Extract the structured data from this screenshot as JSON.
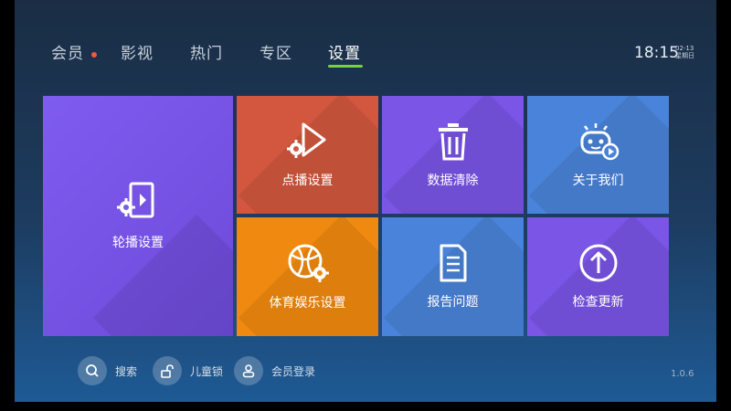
{
  "nav": {
    "items": [
      "会员",
      "影视",
      "热门",
      "专区",
      "设置"
    ],
    "active_index": 4
  },
  "status": {
    "time": "18:15",
    "date": "02-13",
    "weekday": "星期日"
  },
  "tiles": {
    "carousel": {
      "label": "轮播设置"
    },
    "vod": {
      "label": "点播设置"
    },
    "clear_data": {
      "label": "数据清除"
    },
    "about": {
      "label": "关于我们"
    },
    "sports": {
      "label": "体育娱乐设置"
    },
    "report": {
      "label": "报告问题"
    },
    "update": {
      "label": "检查更新"
    }
  },
  "toolbar": {
    "search": "搜索",
    "child_lock": "儿童锁",
    "member_login": "会员登录"
  },
  "version": "1.0.6",
  "colors": {
    "accent_green": "#7ad13a",
    "notification_dot": "#ef5a3c",
    "tile_purple": "#7a55e6",
    "tile_red": "#d2573e",
    "tile_orange": "#f0890f",
    "tile_blue": "#4a84da"
  },
  "icons": {
    "carousel": "carousel-settings-icon",
    "vod": "play-gear-icon",
    "clear_data": "trash-icon",
    "about": "robot-face-icon",
    "sports": "ball-gear-icon",
    "report": "document-icon",
    "update": "arrow-up-circle-icon"
  }
}
